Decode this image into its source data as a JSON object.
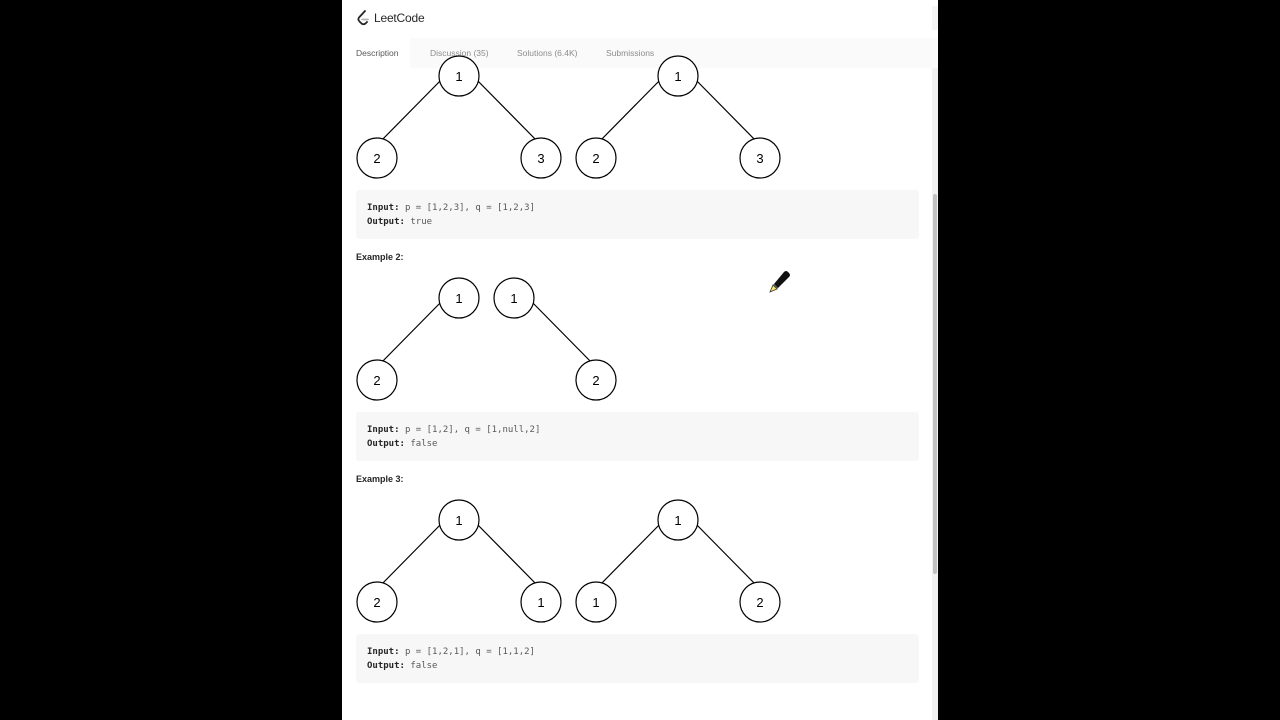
{
  "app": {
    "logo_text": "LeetCode"
  },
  "tabs": [
    {
      "label": "Description"
    },
    {
      "label": "Discussion (35)"
    },
    {
      "label": "Solutions (6.4K)"
    },
    {
      "label": "Submissions"
    }
  ],
  "examples": [
    {
      "title": "",
      "trees": [
        {
          "root": "1",
          "left": "2",
          "right": "3"
        },
        {
          "root": "1",
          "left": "2",
          "right": "3"
        }
      ],
      "input_label": "Input:",
      "input_value": "p = [1,2,3], q = [1,2,3]",
      "output_label": "Output:",
      "output_value": "true"
    },
    {
      "title": "Example 2:",
      "trees": [
        {
          "root": "1",
          "left": "2"
        },
        {
          "root": "1",
          "right": "2"
        }
      ],
      "input_label": "Input:",
      "input_value": "p = [1,2], q = [1,null,2]",
      "output_label": "Output:",
      "output_value": "false"
    },
    {
      "title": "Example 3:",
      "trees": [
        {
          "root": "1",
          "left": "2",
          "right": "1"
        },
        {
          "root": "1",
          "left": "1",
          "right": "2"
        }
      ],
      "input_label": "Input:",
      "input_value": "p = [1,2,1], q = [1,1,2]",
      "output_label": "Output:",
      "output_value": "false"
    }
  ],
  "colors": {
    "accent": "#ffa116",
    "text": "#262626",
    "code_bg": "#f7f7f7"
  }
}
